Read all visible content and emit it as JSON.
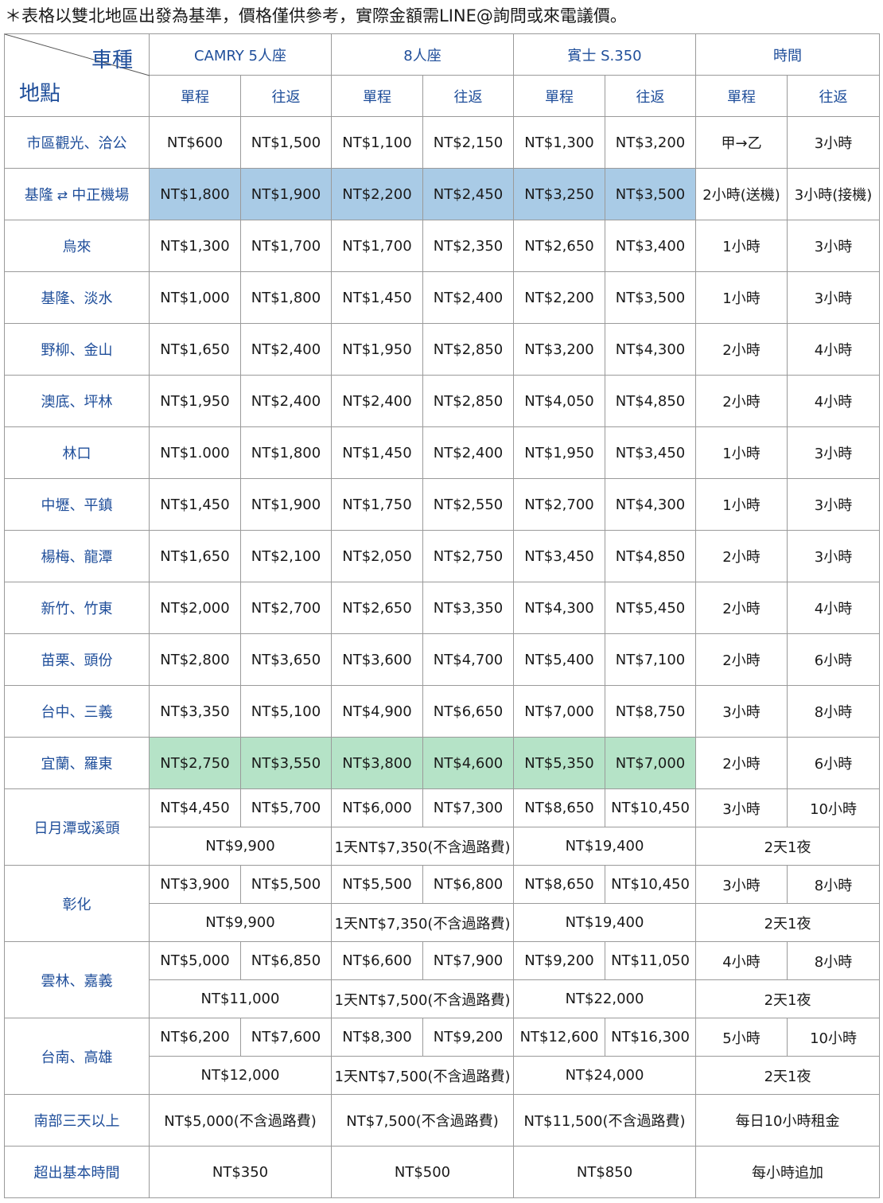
{
  "note": "＊表格以雙北地區出發為基準，價格僅供參考，實際金額需LINE@詢問或來電議價。",
  "header": {
    "corner_top": "車種",
    "corner_bottom": "地點",
    "groups": [
      "CAMRY 5人座",
      "8人座",
      "賓士 S.350",
      "時間"
    ],
    "sub": [
      "單程",
      "往返"
    ]
  },
  "rows": [
    {
      "loc": "市區觀光、洽公",
      "v": [
        "NT$600",
        "NT$1,500",
        "NT$1,100",
        "NT$2,150",
        "NT$1,300",
        "NT$3,200"
      ],
      "t": [
        "甲→乙",
        "3小時"
      ]
    },
    {
      "loc_a": "基隆",
      "loc_b": "中正機場",
      "v": [
        "NT$1,800",
        "NT$1,900",
        "NT$2,200",
        "NT$2,450",
        "NT$3,250",
        "NT$3,500"
      ],
      "t": [
        "2小時(送機)",
        "3小時(接機)"
      ]
    },
    {
      "loc": "烏來",
      "v": [
        "NT$1,300",
        "NT$1,700",
        "NT$1,700",
        "NT$2,350",
        "NT$2,650",
        "NT$3,400"
      ],
      "t": [
        "1小時",
        "3小時"
      ]
    },
    {
      "loc": "基隆、淡水",
      "v": [
        "NT$1,000",
        "NT$1,800",
        "NT$1,450",
        "NT$2,400",
        "NT$2,200",
        "NT$3,500"
      ],
      "t": [
        "1小時",
        "3小時"
      ]
    },
    {
      "loc": "野柳、金山",
      "v": [
        "NT$1,650",
        "NT$2,400",
        "NT$1,950",
        "NT$2,850",
        "NT$3,200",
        "NT$4,300"
      ],
      "t": [
        "2小時",
        "4小時"
      ]
    },
    {
      "loc": "澳底、坪林",
      "v": [
        "NT$1,950",
        "NT$2,400",
        "NT$2,400",
        "NT$2,850",
        "NT$4,050",
        "NT$4,850"
      ],
      "t": [
        "2小時",
        "4小時"
      ]
    },
    {
      "loc": "林口",
      "v": [
        "NT$1.000",
        "NT$1,800",
        "NT$1,450",
        "NT$2,400",
        "NT$1,950",
        "NT$3,450"
      ],
      "t": [
        "1小時",
        "3小時"
      ]
    },
    {
      "loc": "中壢、平鎮",
      "v": [
        "NT$1,450",
        "NT$1,900",
        "NT$1,750",
        "NT$2,550",
        "NT$2,700",
        "NT$4,300"
      ],
      "t": [
        "1小時",
        "3小時"
      ]
    },
    {
      "loc": "楊梅、龍潭",
      "v": [
        "NT$1,650",
        "NT$2,100",
        "NT$2,050",
        "NT$2,750",
        "NT$3,450",
        "NT$4,850"
      ],
      "t": [
        "2小時",
        "3小時"
      ]
    },
    {
      "loc": "新竹、竹東",
      "v": [
        "NT$2,000",
        "NT$2,700",
        "NT$2,650",
        "NT$3,350",
        "NT$4,300",
        "NT$5,450"
      ],
      "t": [
        "2小時",
        "4小時"
      ]
    },
    {
      "loc": "苗栗、頭份",
      "v": [
        "NT$2,800",
        "NT$3,650",
        "NT$3,600",
        "NT$4,700",
        "NT$5,400",
        "NT$7,100"
      ],
      "t": [
        "2小時",
        "6小時"
      ]
    },
    {
      "loc": "台中、三義",
      "v": [
        "NT$3,350",
        "NT$5,100",
        "NT$4,900",
        "NT$6,650",
        "NT$7,000",
        "NT$8,750"
      ],
      "t": [
        "3小時",
        "8小時"
      ]
    },
    {
      "loc": "宜蘭、羅東",
      "v": [
        "NT$2,750",
        "NT$3,550",
        "NT$3,800",
        "NT$4,600",
        "NT$5,350",
        "NT$7,000"
      ],
      "t": [
        "2小時",
        "6小時"
      ]
    }
  ],
  "double_rows": [
    {
      "loc": "日月潭或溪頭",
      "v": [
        "NT$4,450",
        "NT$5,700",
        "NT$6,000",
        "NT$7,300",
        "NT$8,650",
        "NT$10,450"
      ],
      "t": [
        "3小時",
        "10小時"
      ],
      "m": [
        "NT$9,900",
        "1天NT$7,350(不含過路費)",
        "NT$19,400",
        "2天1夜"
      ]
    },
    {
      "loc": "彰化",
      "v": [
        "NT$3,900",
        "NT$5,500",
        "NT$5,500",
        "NT$6,800",
        "NT$8,650",
        "NT$10,450"
      ],
      "t": [
        "3小時",
        "8小時"
      ],
      "m": [
        "NT$9,900",
        "1天NT$7,350(不含過路費)",
        "NT$19,400",
        "2天1夜"
      ]
    },
    {
      "loc": "雲林、嘉義",
      "v": [
        "NT$5,000",
        "NT$6,850",
        "NT$6,600",
        "NT$7,900",
        "NT$9,200",
        "NT$11,050"
      ],
      "t": [
        "4小時",
        "8小時"
      ],
      "m": [
        "NT$11,000",
        "1天NT$7,500(不含過路費)",
        "NT$22,000",
        "2天1夜"
      ]
    },
    {
      "loc": "台南、高雄",
      "v": [
        "NT$6,200",
        "NT$7,600",
        "NT$8,300",
        "NT$9,200",
        "NT$12,600",
        "NT$16,300"
      ],
      "t": [
        "5小時",
        "10小時"
      ],
      "m": [
        "NT$12,000",
        "1天NT$7,500(不含過路費)",
        "NT$24,000",
        "2天1夜"
      ]
    }
  ],
  "footer_rows": [
    {
      "loc": "南部三天以上",
      "m": [
        "NT$5,000(不含過路費)",
        "NT$7,500(不含過路費)",
        "NT$11,500(不含過路費)",
        "每日10小時租金"
      ]
    },
    {
      "loc": "超出基本時間",
      "m": [
        "NT$350",
        "NT$500",
        "NT$850",
        "每小時追加"
      ]
    }
  ],
  "colors": {
    "blue_highlight": "#a9cbe6",
    "green_highlight": "#b5e3c7",
    "text_blue": "#1f4e9a"
  }
}
